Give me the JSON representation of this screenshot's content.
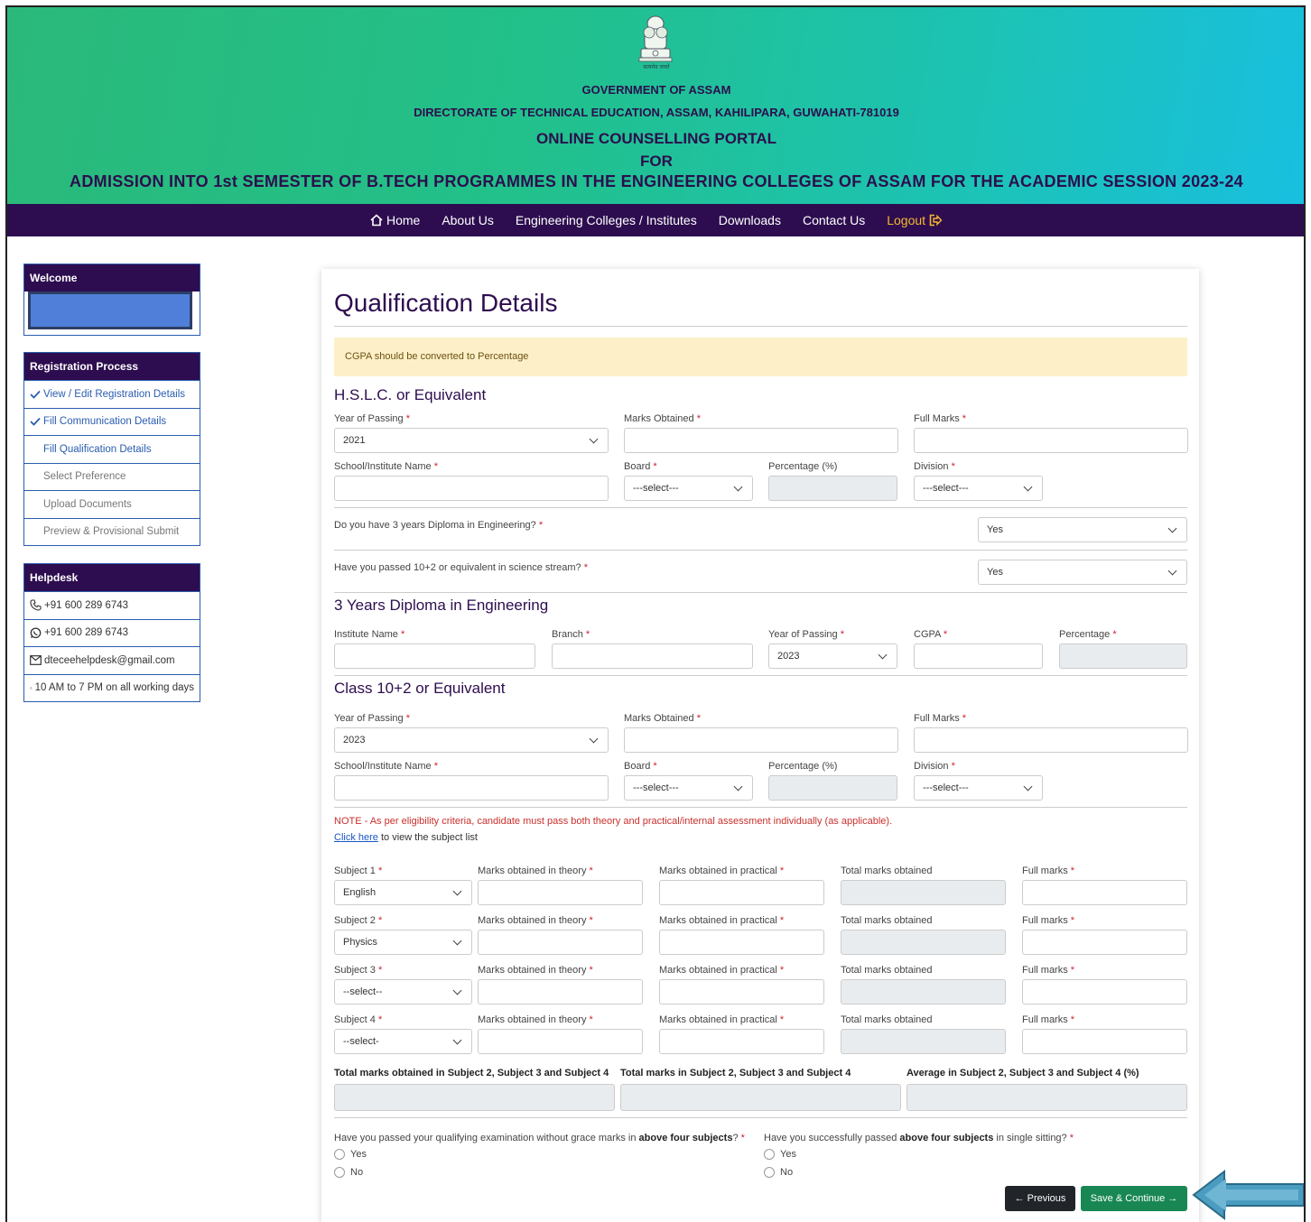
{
  "banner": {
    "line1": "GOVERNMENT OF ASSAM",
    "line2": "DIRECTORATE OF TECHNICAL EDUCATION, ASSAM, KAHILIPARA, GUWAHATI-781019",
    "line3": "ONLINE COUNSELLING PORTAL",
    "line4": "FOR",
    "line5": "ADMISSION INTO 1st SEMESTER OF B.TECH PROGRAMMES IN THE ENGINEERING COLLEGES OF ASSAM FOR THE ACADEMIC SESSION 2023-24",
    "emblem_text": "सत्यमेव जयते"
  },
  "nav": {
    "home": "Home",
    "about": "About Us",
    "colleges": "Engineering Colleges / Institutes",
    "downloads": "Downloads",
    "contact": "Contact Us",
    "logout": "Logout"
  },
  "sidebar": {
    "welcome": "Welcome",
    "registration_title": "Registration Process",
    "steps": [
      "View / Edit Registration Details",
      "Fill Communication Details",
      "Fill Qualification Details",
      "Select Preference",
      "Upload Documents",
      "Preview & Provisional Submit"
    ],
    "helpdesk_title": "Helpdesk",
    "phone": "+91 600 289 6743",
    "whatsapp": "+91 600 289 6743",
    "email": "dteceehelpdesk@gmail.com",
    "hours": "10 AM to 7 PM on all working days"
  },
  "form": {
    "title": "Qualification Details",
    "alert": "CGPA should be converted to Percentage",
    "req": "*",
    "hslc": {
      "heading": "H.S.L.C. or Equivalent",
      "year_label": "Year of Passing",
      "year_value": "2021",
      "marks_label": "Marks Obtained",
      "full_label": "Full Marks",
      "school_label": "School/Institute Name",
      "board_label": "Board",
      "board_value": "---select---",
      "pct_label": "Percentage (%)",
      "div_label": "Division",
      "div_value": "---select---"
    },
    "q_diploma": "Do you have 3 years Diploma in Engineering?",
    "q_diploma_value": "Yes",
    "q_science": "Have you passed 10+2 or equivalent in science stream?",
    "q_science_value": "Yes",
    "diploma": {
      "heading": "3 Years Diploma in Engineering",
      "inst_label": "Institute Name",
      "branch_label": "Branch",
      "year_label": "Year of Passing",
      "year_value": "2023",
      "cgpa_label": "CGPA",
      "pct_label": "Percentage"
    },
    "class12": {
      "heading": "Class 10+2 or Equivalent",
      "year_label": "Year of Passing",
      "year_value": "2023",
      "marks_label": "Marks Obtained",
      "full_label": "Full Marks",
      "school_label": "School/Institute Name",
      "board_label": "Board",
      "board_value": "---select---",
      "pct_label": "Percentage (%)",
      "div_label": "Division",
      "div_value": "---select---"
    },
    "note": "NOTE - As per eligibility criteria, candidate must pass both theory and practical/internal assessment individually (as applicable).",
    "click_here": "Click here",
    "click_rest": " to view the subject list",
    "subjects": [
      {
        "label": "Subject 1",
        "value": "English"
      },
      {
        "label": "Subject 2",
        "value": "Physics"
      },
      {
        "label": "Subject 3",
        "value": "--select--"
      },
      {
        "label": "Subject 4",
        "value": "--select-"
      }
    ],
    "theory_label": "Marks obtained in theory",
    "practical_label": "Marks obtained in practical",
    "total_label": "Total marks obtained",
    "full_marks_label": "Full marks",
    "sum_total_label": "Total marks obtained in Subject 2, Subject 3 and Subject 4",
    "sum_full_label": "Total marks in Subject 2, Subject 3 and Subject 4",
    "sum_avg_label": "Average in Subject 2, Subject 3 and Subject 4 (%)",
    "grace_q_pre": "Have you passed your qualifying examination without grace marks in ",
    "grace_q_bold": "above four subjects",
    "grace_q_post": "?",
    "sitting_q_pre": "Have you successfully passed ",
    "sitting_q_bold": "above four subjects",
    "sitting_q_post": " in single sitting?",
    "yes": "Yes",
    "no": "No",
    "prev_btn": "← Previous",
    "save_btn": "Save & Continue →"
  },
  "colors": {
    "purple": "#2d0d4f",
    "green_btn": "#198754",
    "arrow": "#4a9cc0"
  }
}
